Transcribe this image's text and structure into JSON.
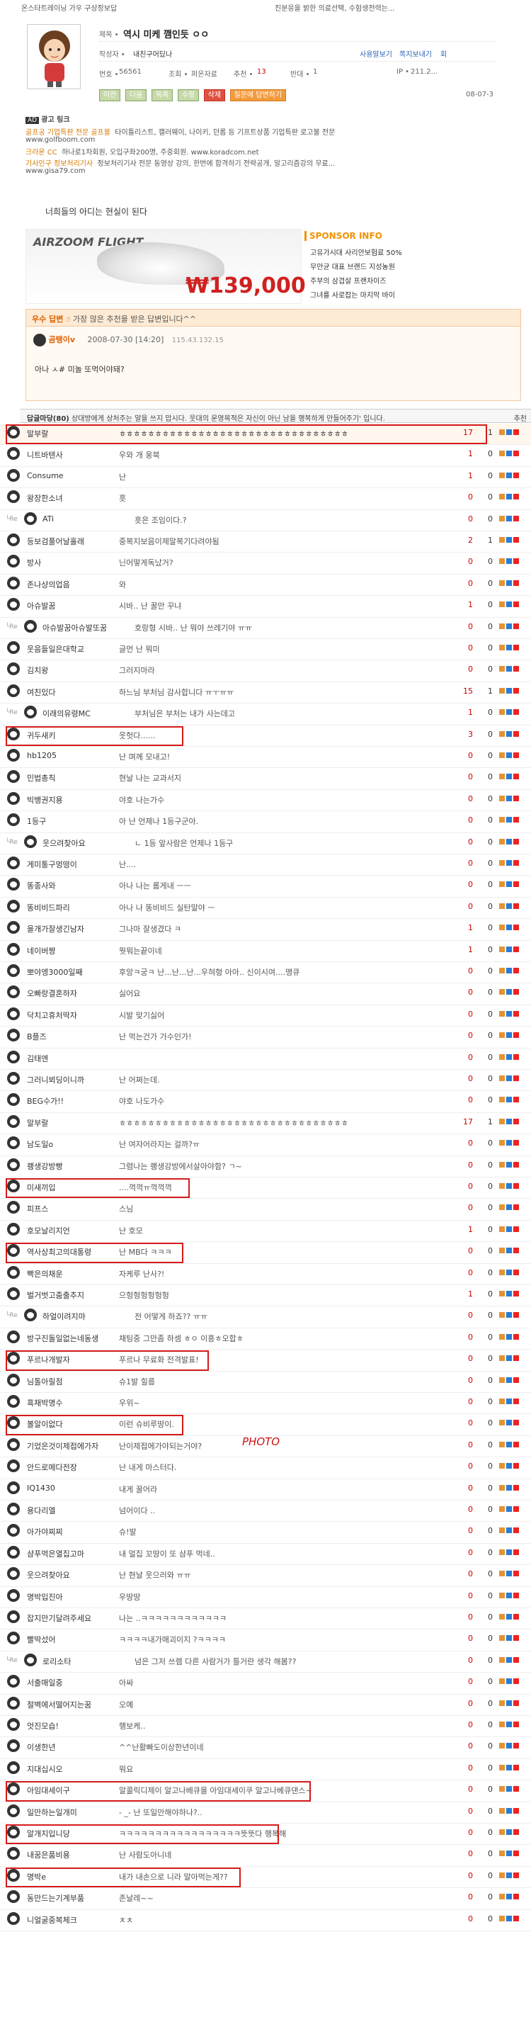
{
  "top_links": [
    "온스타트레이닝 가우 구상정보답",
    "진분응을 밝한 의료선택, 수험생전력는..."
  ],
  "post": {
    "title_label": "제목 •",
    "title": "역시 미케 깸인듯 ㅇㅇ",
    "author_label": "작성자 •",
    "author": "내친구어딨나",
    "no_label": "번호 •",
    "no": "56561",
    "views_label": "조회 •",
    "views": "퍼온자료",
    "recommend_label": "추천 •",
    "recommend": "13",
    "opp_label": "반대 •",
    "opp": "1",
    "ip_label": "IP •",
    "ip": "211.2...",
    "date": "08-07-3",
    "profile_link": "사용말보기",
    "note_link": "쪽지보내기",
    "extra_link": "회",
    "buttons": [
      "이전",
      "다음",
      "목록",
      "수정",
      "삭제",
      "질문에 답변하기"
    ]
  },
  "ad": {
    "tag": "AD",
    "label": "광고 링크",
    "rows": [
      {
        "title": "골프공 기업특판 전문 골프볼",
        "desc": "타이틀리스트, 캘러웨이, 나이키, 던롭 등 기프트상품 기업특판 로고볼 전문",
        "url": "www.golfboom.com"
      },
      {
        "title": "크라운 CC",
        "desc": "하나로1차회원, 오입구좌200명, 주중회원.  www.koradcom.net",
        "url": ""
      },
      {
        "title": "기사인구 정보처리기사",
        "desc": "정보처리기사 전문 동영상 강의, 한번에 합격하기 전략공개, 알고리즘강의 무료...",
        "url": "www.gisa79.com"
      }
    ]
  },
  "quote": "너희들의 아디는 현실이 된다",
  "banner": {
    "brand": "AIRZOOM FLIGHT",
    "price": "₩139,000"
  },
  "sponsor": {
    "title": "SPONSOR INFO",
    "items": [
      "고유가시대 사리안보험료 50%",
      "무안균 대표 브랜드 지성농원",
      "주부의 삼겹살 프랜차이즈",
      "그녀를 사로잡는 마지막 바이"
    ]
  },
  "best_answer": {
    "badge": "우수 답변",
    "desc": "가장 많은 추천을 받은 답변입니다^^",
    "name": "곰탱이v",
    "date": "2008-07-30 [14:20]",
    "ip": "115.43.132.15",
    "text": "아나 ㅅ# 미놀 또먹어야돼?"
  },
  "comments_header": {
    "title": "답글마당(80)",
    "desc": "상대방에게 상처주는 말을 쓰지 맙시다. 웃대의 운영목적은 자신이 아닌 남을 행복하게 만들어주기' 입니다.",
    "right": "추천"
  },
  "comments": [
    {
      "best": true,
      "nick": "말부랄",
      "text": "ㅎㅎㅎㅎㅎㅎㅎㅎㅎㅎㅎㅎㅎㅎㅎㅎㅎㅎㅎㅎㅎㅎㅎㅎㅎㅎㅎㅎㅎㅎㅎㅎ",
      "rec": "17",
      "opp": "1"
    },
    {
      "nick": "니트바텐사",
      "text": "우와 개 웅북",
      "rec": "1",
      "opp": "0"
    },
    {
      "nick": "Consume",
      "text": "난",
      "rec": "1",
      "opp": "0"
    },
    {
      "nick": "왕장한소녀",
      "text": "흣",
      "rec": "0",
      "opp": "0"
    },
    {
      "reply": true,
      "nick": "ATi",
      "text": "흣은 조임이다.?",
      "rec": "0",
      "opp": "0"
    },
    {
      "nick": "등보검풀어날홀래",
      "text": "중복지보음이제말복기다려야됨",
      "rec": "2",
      "opp": "1"
    },
    {
      "nick": "방사",
      "text": "닌어떻게독났거?",
      "rec": "0",
      "opp": "0"
    },
    {
      "nick": "존나샹의업음",
      "text": "와",
      "rec": "0",
      "opp": "0"
    },
    {
      "nick": "아슈발꿈",
      "text": "시바.. 난 꿀만 꾸냐",
      "rec": "1",
      "opp": "0"
    },
    {
      "reply": true,
      "nick": "아슈발꿈아슈발또꿈",
      "text": "호랑형 시바.. 난 뭐야 쓰레기야 ㅠㅠ",
      "rec": "0",
      "opp": "0"
    },
    {
      "nick": "웃음들일은대학교",
      "text": "글먼 난 뭐미",
      "rec": "0",
      "opp": "0"
    },
    {
      "nick": "김치왕",
      "text": "그러지마라",
      "rec": "0",
      "opp": "0"
    },
    {
      "nick": "여친있다",
      "text": "하느님 부처님 감사합니다 ㅠㅜㅠㅠ",
      "rec": "15",
      "opp": "1"
    },
    {
      "reply": true,
      "nick": "이래의유령MC",
      "text": "부처님은 부처는 내가 사는데고",
      "rec": "1",
      "opp": "0"
    },
    {
      "nick": "귀두새키",
      "text": "웃헛다......",
      "rec": "3",
      "opp": "0"
    },
    {
      "nick": "hb1205",
      "text": "난 며께 모내고!",
      "rec": "0",
      "opp": "0"
    },
    {
      "nick": "민법총칙",
      "text": "현날 나는 교과서지",
      "rec": "0",
      "opp": "0"
    },
    {
      "nick": "빅뱅권지용",
      "text": "야호 나는가수",
      "rec": "0",
      "opp": "0"
    },
    {
      "nick": "1등구",
      "text": "아 난 언제나 1등구군아.",
      "rec": "0",
      "opp": "0"
    },
    {
      "reply": true,
      "nick": "웃으려찾아요",
      "text": "ㄴ 1등 앞사람은 언제나 1등구",
      "rec": "0",
      "opp": "0"
    },
    {
      "nick": "게미통구멍떵이",
      "text": "난....",
      "rec": "0",
      "opp": "0"
    },
    {
      "nick": "똥종사와",
      "text": "아나 나는 롬게내 ㅡㅡ",
      "rec": "0",
      "opp": "0"
    },
    {
      "nick": "똥비비드파리",
      "text": "아나 나 똥비비드 실탄말야 ㅡ",
      "rec": "0",
      "opp": "0"
    },
    {
      "nick": "을개가잘생긴남자",
      "text": "그나마 잘생겼다 ㅋ",
      "rec": "1",
      "opp": "0"
    },
    {
      "nick": "네이버짱",
      "text": "뭣뭐는끝이네",
      "rec": "1",
      "opp": "0"
    },
    {
      "nick": "뽀야엥3000일째",
      "text": "후앙ㅋ궁ㅋ 난...난...난...우혀형 아아.. 신이시여....맹큐",
      "rec": "0",
      "opp": "0"
    },
    {
      "nick": "오빠랑결혼하자",
      "text": "싫어요",
      "rec": "0",
      "opp": "0"
    },
    {
      "nick": "닥치고휴처딱자",
      "text": "시발 맞기싫어",
      "rec": "0",
      "opp": "0"
    },
    {
      "nick": "B플즈",
      "text": "난 먹는건가 가수인가!",
      "rec": "0",
      "opp": "0"
    },
    {
      "nick": "김태엔",
      "text": "",
      "rec": "0",
      "opp": "0"
    },
    {
      "nick": "그러니뵈딩이니까",
      "text": "난 어쩌는데.",
      "rec": "0",
      "opp": "0"
    },
    {
      "nick": "BEG수가!!",
      "text": "야호 나도가수",
      "rec": "0",
      "opp": "0"
    },
    {
      "nick": "말부랄",
      "text": "ㅎㅎㅎㅎㅎㅎㅎㅎㅎㅎㅎㅎㅎㅎㅎㅎㅎㅎㅎㅎㅎㅎㅎㅎㅎㅎㅎㅎㅎㅎㅎㅎ",
      "rec": "17",
      "opp": "1"
    },
    {
      "nick": "남도일o",
      "text": "난 여자어라지는 걸까?ㅠ",
      "rec": "0",
      "opp": "0"
    },
    {
      "nick": "쾡생강방빵",
      "text": "그렴나는 쾡생강방에서살아야함? ㄱ~",
      "rec": "0",
      "opp": "0"
    },
    {
      "nick": "미새끼입",
      "text": "....꺽꺽ㅠ꺽꺽꺽",
      "rec": "0",
      "opp": "0"
    },
    {
      "nick": "피프스",
      "text": "스님",
      "rec": "0",
      "opp": "0"
    },
    {
      "nick": "호모날리지언",
      "text": "난 호모",
      "rec": "1",
      "opp": "0"
    },
    {
      "nick": "역사상최고의대통령",
      "text": "난 MB다 ㅋㅋㅋ",
      "rec": "0",
      "opp": "0"
    },
    {
      "nick": "빡은의채운",
      "text": "자케루 난사?!",
      "rec": "0",
      "opp": "0"
    },
    {
      "nick": "벌거벗고춤출추지",
      "text": "으헝헝헝헝헝헝",
      "rec": "1",
      "opp": "0"
    },
    {
      "reply": true,
      "nick": "하얼이려지마",
      "text": "전 어떻게 하죠?? ㅠㅠ",
      "rec": "0",
      "opp": "0"
    },
    {
      "nick": "방구진돌일없는네동생",
      "text": "채팅중 그만좀 하셈 ㅎㅇ 이흥ㅎ오합ㅎ",
      "rec": "0",
      "opp": "0"
    },
    {
      "nick": "푸르나개발자",
      "text": "푸르나 무료화 전격발표!",
      "rec": "0",
      "opp": "0"
    },
    {
      "nick": "님톨아릴점",
      "text": "슈1발 힐름",
      "rec": "0",
      "opp": "0"
    },
    {
      "nick": "흑채박명수",
      "text": "우위~",
      "rec": "0",
      "opp": "0"
    },
    {
      "nick": "볼알이없다",
      "text": "이런 슈비루땅이.",
      "rec": "0",
      "opp": "0"
    },
    {
      "nick": "기었은것이제접에가자",
      "text": "난이제접에가야되는거야?",
      "rec": "0",
      "opp": "0"
    },
    {
      "nick": "안드로메다전장",
      "text": "난 내게 마스터다.",
      "rec": "0",
      "opp": "0"
    },
    {
      "nick": "IQ1430",
      "text": "내게 꿀어라",
      "rec": "0",
      "opp": "0"
    },
    {
      "nick": "용다리엘",
      "text": "넘어이다 ..",
      "rec": "0",
      "opp": "0"
    },
    {
      "nick": "아가야찌찌",
      "text": "슈!발",
      "rec": "0",
      "opp": "0"
    },
    {
      "nick": "샴푸먹은열집고마",
      "text": "내 얼집 꼬땅이 또 샴푸 먹네..",
      "rec": "0",
      "opp": "0"
    },
    {
      "nick": "웃으려찾아요",
      "text": "난 현날 웃으러와 ㅠㅠ",
      "rec": "0",
      "opp": "0"
    },
    {
      "nick": "명박입진아",
      "text": "우땅땅",
      "rec": "0",
      "opp": "0"
    },
    {
      "nick": "잡지만기달려주세요",
      "text": "나는 ..ㅋㅋㅋㅋㅋㅋㅋㅋㅋㅋㅋㅋ",
      "rec": "0",
      "opp": "0"
    },
    {
      "nick": "빨딱섰어",
      "text": "ㅋㅋㅋㅋ내가매괴이지 ?ㅋㅋㅋㅋ",
      "rec": "0",
      "opp": "0"
    },
    {
      "reply": true,
      "nick": "로리소타",
      "text": "넘은 그저 쓰렘 다른 사람거가 틀거란 생각 해봄??",
      "rec": "0",
      "opp": "0"
    },
    {
      "nick": "서출매일중",
      "text": "아싸",
      "rec": "0",
      "opp": "0"
    },
    {
      "nick": "절벽에서떨어지는꿈",
      "text": "오예",
      "rec": "0",
      "opp": "0"
    },
    {
      "nick": "엇진모습!",
      "text": "행보케..",
      "rec": "0",
      "opp": "0"
    },
    {
      "nick": "이생한년",
      "text": "^^난활빠도이상한년이네",
      "rec": "0",
      "opp": "0"
    },
    {
      "nick": "지대십시오",
      "text": "뭐요",
      "rec": "0",
      "opp": "0"
    },
    {
      "nick": "아임대세이구",
      "text": "알콜릭디제이 알고나베큐몰 아임대세이쿠 알고나베큐댄스~",
      "rec": "0",
      "opp": "0"
    },
    {
      "nick": "일만하는일개미",
      "text": "- _- 난 또일만해야하나?..",
      "rec": "0",
      "opp": "0"
    },
    {
      "nick": "알개지입니당",
      "text": "ㅋㅋㅋㅋㅋㅋㅋㅋㅋㅋㅋㅋㅋㅋㅋㅋㅋ뜻뜻다 행복해",
      "rec": "0",
      "opp": "0"
    },
    {
      "nick": "내꿈은품비용",
      "text": "난 사람도아니네",
      "rec": "0",
      "opp": "0"
    },
    {
      "nick": "명박e",
      "text": "내가 내손으로 니라 말아먹는게??",
      "rec": "0",
      "opp": "0"
    },
    {
      "nick": "동만드는기계부품",
      "text": "존날레~~",
      "rec": "0",
      "opp": "0"
    },
    {
      "nick": "니얼굴중복체크",
      "text": "ㅊㅊ",
      "rec": "0",
      "opp": "0"
    }
  ],
  "scribble": "PHOTO"
}
